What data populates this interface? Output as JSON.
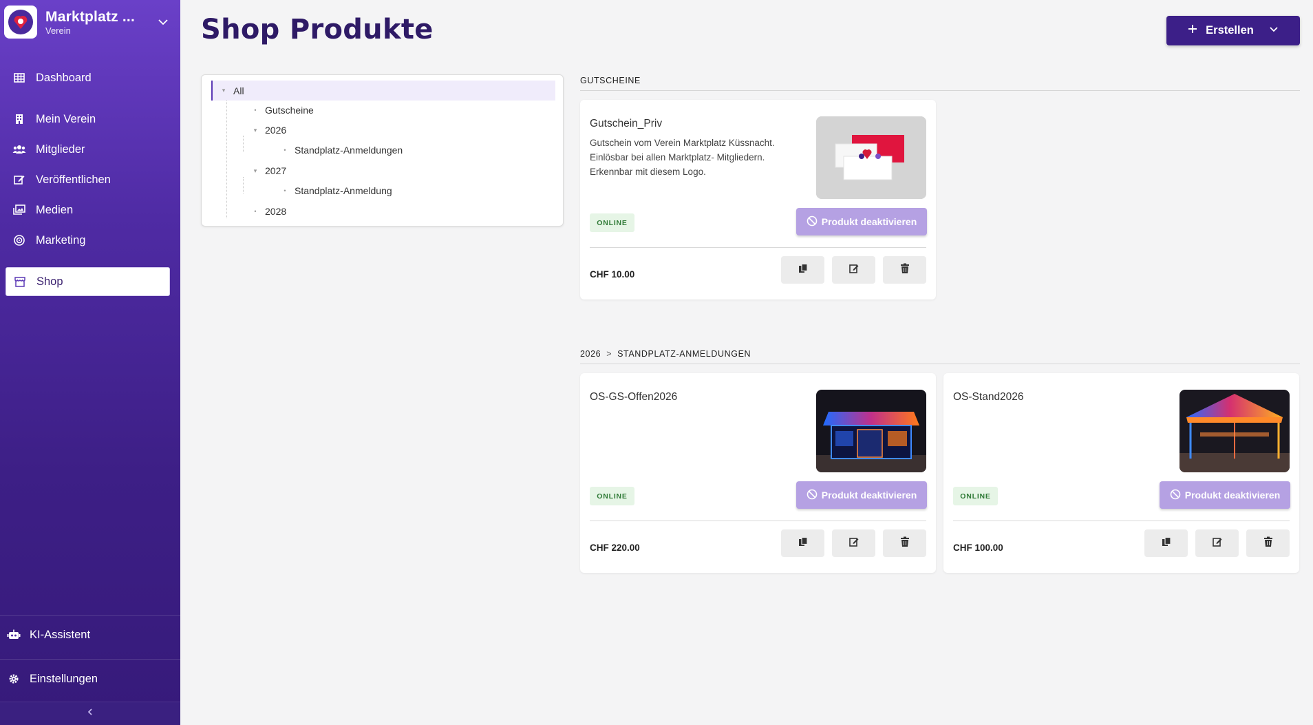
{
  "brand": {
    "name": "Marktplatz ...",
    "subtitle": "Verein"
  },
  "nav": {
    "dashboard": "Dashboard",
    "mein_verein": "Mein Verein",
    "mitglieder": "Mitglieder",
    "veroeffentlichen": "Veröffentlichen",
    "medien": "Medien",
    "marketing": "Marketing",
    "shop": "Shop"
  },
  "bottom_nav": {
    "ki": "KI-Assistent",
    "settings": "Einstellungen"
  },
  "page": {
    "title": "Shop Produkte",
    "create_label": "Erstellen"
  },
  "tree": {
    "all": "All",
    "gutscheine": "Gutscheine",
    "y2026": "2026",
    "standplatz_anmeldungen": "Standplatz-Anmeldungen",
    "y2027": "2027",
    "standplatz_anmeldung": "Standplatz-Anmeldung",
    "y2028": "2028"
  },
  "sections": {
    "gutscheine": {
      "title": "GUTSCHEINE"
    },
    "standplatz": {
      "crumb_year": "2026",
      "separator": ">",
      "crumb_name": "STANDPLATZ-ANMELDUNGEN"
    }
  },
  "products": [
    {
      "title": "Gutschein_Priv",
      "description": "Gutschein vom Verein Marktplatz Küssnacht. Einlösbar bei allen Marktplatz- Mitgliedern. Erkennbar mit diesem Logo.",
      "status": "ONLINE",
      "deactivate_label": "Produkt deaktivieren",
      "price": "CHF 10.00"
    },
    {
      "title": "OS-GS-Offen2026",
      "description": "",
      "status": "ONLINE",
      "deactivate_label": "Produkt deaktivieren",
      "price": "CHF 220.00"
    },
    {
      "title": "OS-Stand2026",
      "description": "",
      "status": "ONLINE",
      "deactivate_label": "Produkt deaktivieren",
      "price": "CHF 100.00"
    }
  ],
  "colors": {
    "primary": "#3c1f88",
    "sidebar_top": "#6a40c8",
    "sidebar_bottom": "#361a7a",
    "deactivate": "#b5a1e3",
    "online_bg": "#e6f5e6",
    "online_text": "#2f7a36"
  }
}
